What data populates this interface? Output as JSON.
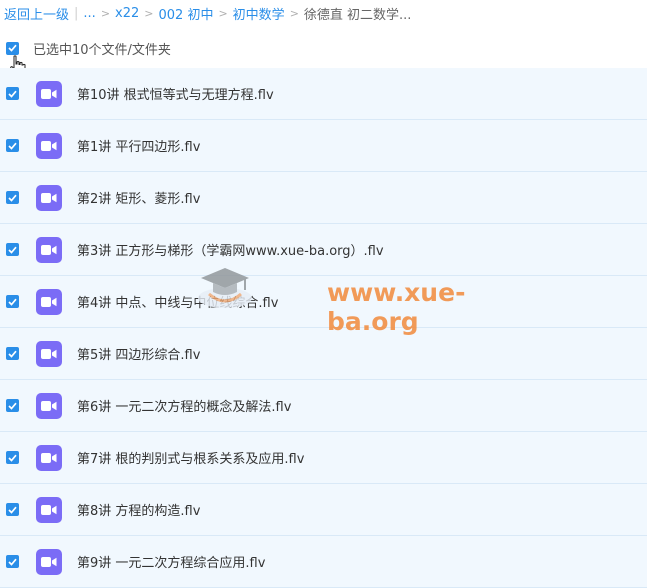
{
  "breadcrumb": {
    "back": "返回上一级",
    "ellipsis": "...",
    "items": [
      "x22",
      "002 初中",
      "初中数学"
    ],
    "current": "徐德直 初二数学..."
  },
  "selection": {
    "text": "已选中10个文件/文件夹"
  },
  "files": [
    "第10讲 根式恒等式与无理方程.flv",
    "第1讲 平行四边形.flv",
    "第2讲 矩形、菱形.flv",
    "第3讲 正方形与梯形（学霸网www.xue-ba.org）.flv",
    "第4讲 中点、中线与中位线综合.flv",
    "第5讲 四边形综合.flv",
    "第6讲 一元二次方程的概念及解法.flv",
    "第7讲 根的判别式与根系关系及应用.flv",
    "第8讲 方程的构造.flv",
    "第9讲 一元二次方程综合应用.flv"
  ],
  "watermark": {
    "text": "www.xue-ba.org"
  },
  "colors": {
    "accent": "#2a8ee8",
    "row_bg": "#f1f8fe",
    "video_icon": "#7b6cf6",
    "watermark": "#f28a3c"
  },
  "icons": {
    "file": "video-file-icon",
    "checkbox": "checkbox-checked-icon"
  }
}
